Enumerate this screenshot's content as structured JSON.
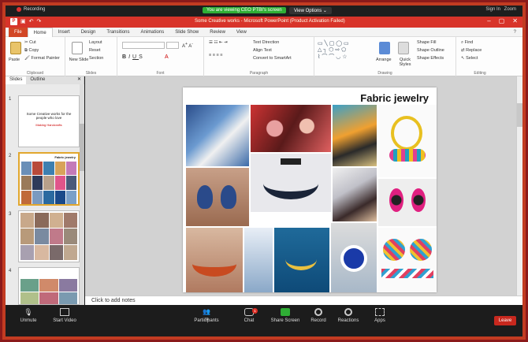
{
  "zoom": {
    "recording_label": "Recording",
    "viewing_banner": "You are viewing CEO PTBI's screen",
    "view_options": "View Options",
    "signin": "Sign In",
    "zoom_btn": "Zoom",
    "bar": {
      "unmute": "Unmute",
      "start_video": "Start Video",
      "participants": "Participants",
      "participants_count": "74",
      "chat": "Chat",
      "chat_badge": "1",
      "share_screen": "Share Screen",
      "record": "Record",
      "reactions": "Reactions",
      "apps": "Apps",
      "leave": "Leave"
    }
  },
  "powerpoint": {
    "window_title": "Some Creative works - Microsoft PowerPoint (Product Activation Failed)",
    "tabs": [
      "File",
      "Home",
      "Insert",
      "Design",
      "Transitions",
      "Animations",
      "Slide Show",
      "Review",
      "View"
    ],
    "ribbon": {
      "clipboard": {
        "paste": "Paste",
        "cut": "Cut",
        "copy": "Copy",
        "format_painter": "Format Painter",
        "label": "Clipboard"
      },
      "slides": {
        "new_slide": "New Slide",
        "layout": "Layout",
        "reset": "Reset",
        "section": "Section",
        "label": "Slides"
      },
      "font": {
        "label": "Font"
      },
      "paragraph": {
        "text_direction": "Text Direction",
        "align_text": "Align Text",
        "convert_smartart": "Convert to SmartArt",
        "label": "Paragraph"
      },
      "drawing": {
        "arrange": "Arrange",
        "quick_styles": "Quick Styles",
        "shape_fill": "Shape Fill",
        "shape_outline": "Shape Outline",
        "shape_effects": "Shape Effects",
        "label": "Drawing"
      },
      "editing": {
        "find": "Find",
        "replace": "Replace",
        "select": "Select",
        "label": "Editing"
      }
    },
    "pane_tabs": [
      "Slides",
      "Outline"
    ],
    "thumbs": [
      {
        "num": "1",
        "text": "Some Creative works for the people who love",
        "sub": "Making Handcrafts"
      },
      {
        "num": "2",
        "text": "Fabric jewelry"
      },
      {
        "num": "3"
      },
      {
        "num": "4"
      }
    ],
    "slide_title": "Fabric jewelry",
    "notes_placeholder": "Click to add notes"
  },
  "colors": {
    "zoom_green": "#2fae35",
    "pp_red": "#d8342a",
    "leave_red": "#c8281e",
    "frame_red": "#c23b22"
  }
}
